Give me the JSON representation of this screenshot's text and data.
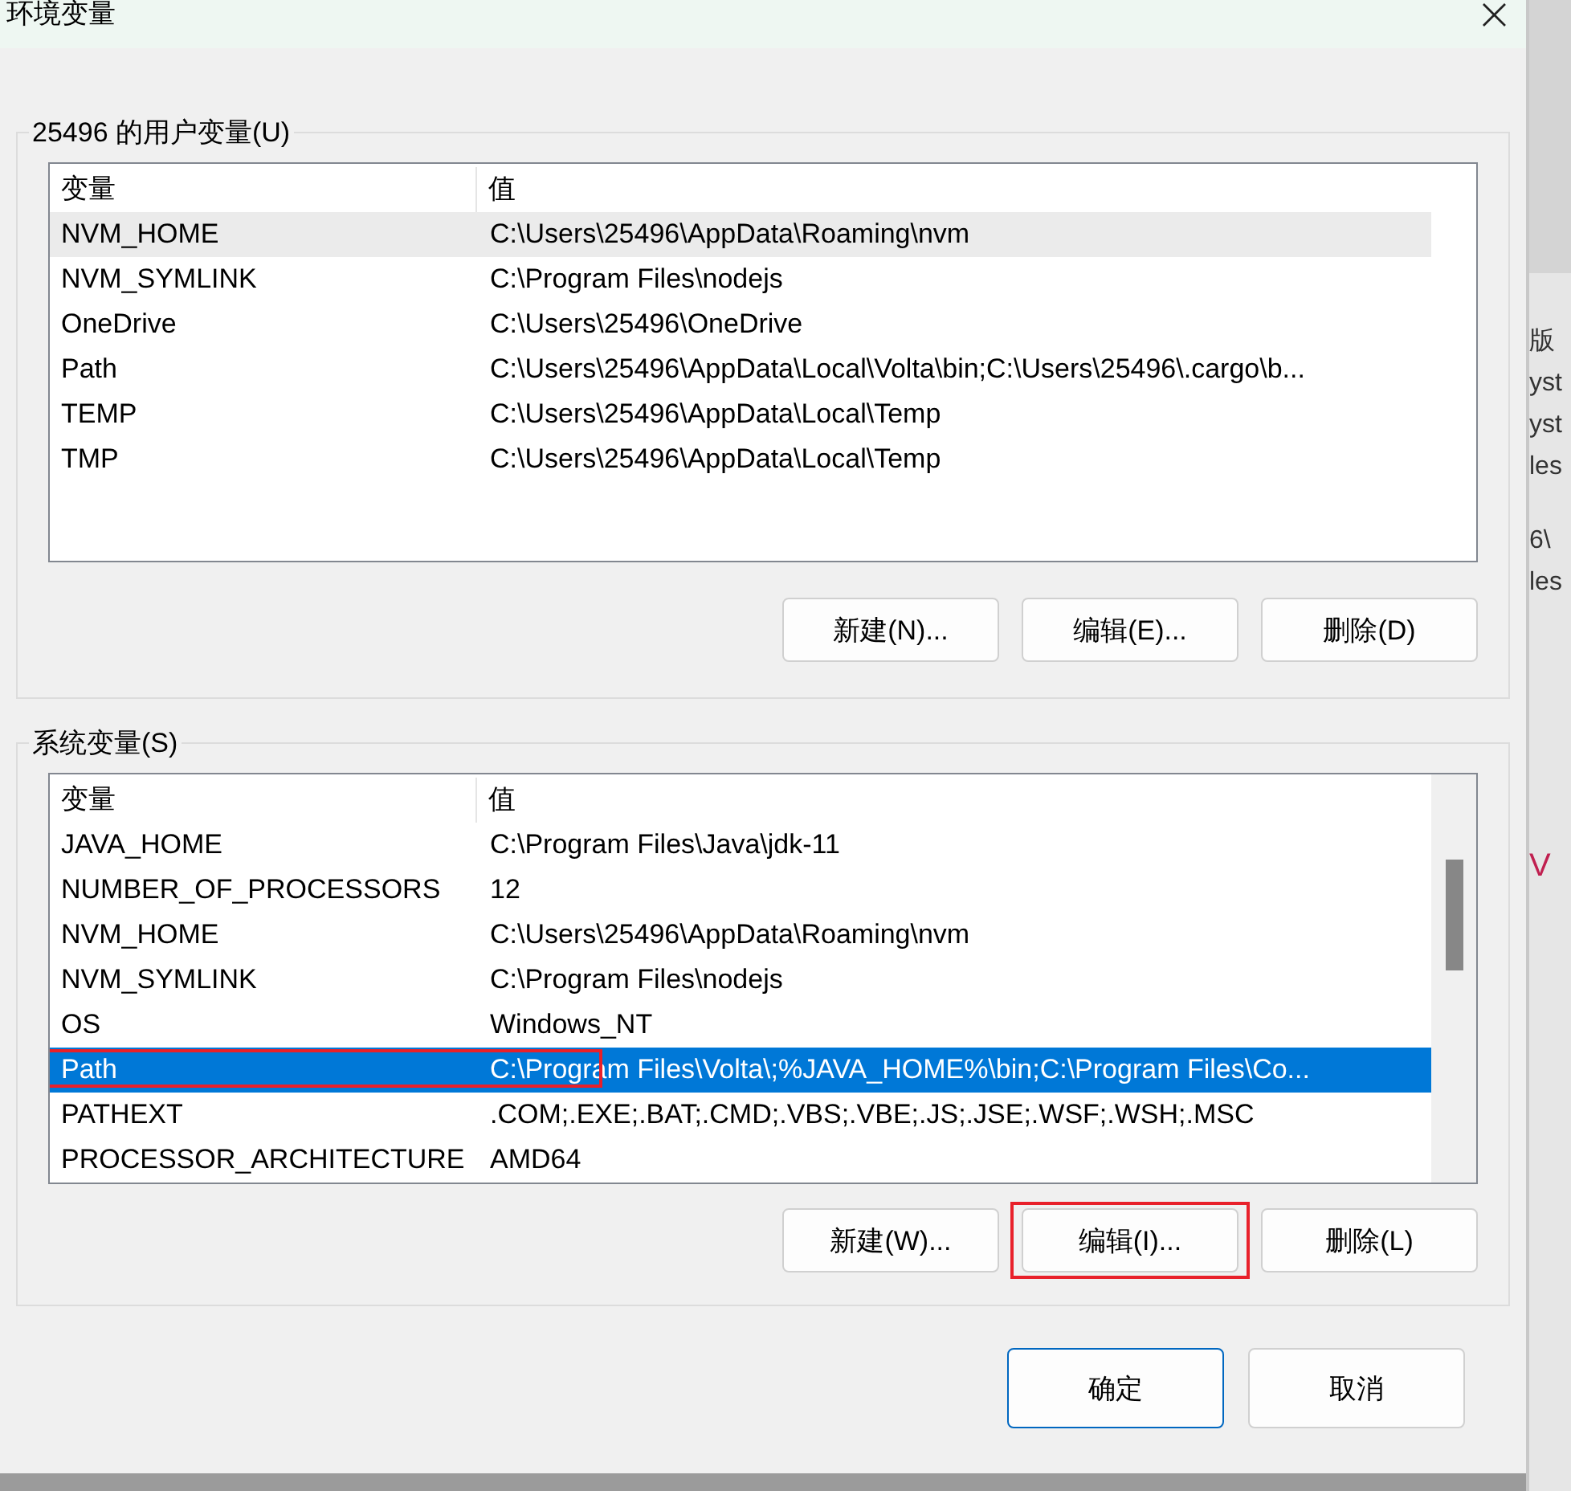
{
  "window": {
    "title": "环境变量",
    "close": "×"
  },
  "user_variables": {
    "legend": "25496 的用户变量(U)",
    "columns": [
      "变量",
      "值"
    ],
    "rows": [
      {
        "name": "NVM_HOME",
        "value": "C:\\Users\\25496\\AppData\\Roaming\\nvm",
        "selected": false,
        "hovered": true,
        "highlighted": false
      },
      {
        "name": "NVM_SYMLINK",
        "value": "C:\\Program Files\\nodejs",
        "selected": false,
        "hovered": false,
        "highlighted": false
      },
      {
        "name": "OneDrive",
        "value": "C:\\Users\\25496\\OneDrive",
        "selected": false,
        "hovered": false,
        "highlighted": false
      },
      {
        "name": "Path",
        "value": "C:\\Users\\25496\\AppData\\Local\\Volta\\bin;C:\\Users\\25496\\.cargo\\b...",
        "selected": false,
        "hovered": false,
        "highlighted": false
      },
      {
        "name": "TEMP",
        "value": "C:\\Users\\25496\\AppData\\Local\\Temp",
        "selected": false,
        "hovered": false,
        "highlighted": false
      },
      {
        "name": "TMP",
        "value": "C:\\Users\\25496\\AppData\\Local\\Temp",
        "selected": false,
        "hovered": false,
        "highlighted": false
      }
    ],
    "buttons": [
      {
        "label": "新建(N)...",
        "highlighted": false
      },
      {
        "label": "编辑(E)...",
        "highlighted": false
      },
      {
        "label": "删除(D)",
        "highlighted": false
      }
    ]
  },
  "system_variables": {
    "legend": "系统变量(S)",
    "columns": [
      "变量",
      "值"
    ],
    "scrollbar": true,
    "rows": [
      {
        "name": "JAVA_HOME",
        "value": "C:\\Program Files\\Java\\jdk-11",
        "selected": false,
        "hovered": false,
        "highlighted": false
      },
      {
        "name": "NUMBER_OF_PROCESSORS",
        "value": "12",
        "selected": false,
        "hovered": false,
        "highlighted": false
      },
      {
        "name": "NVM_HOME",
        "value": "C:\\Users\\25496\\AppData\\Roaming\\nvm",
        "selected": false,
        "hovered": false,
        "highlighted": false
      },
      {
        "name": "NVM_SYMLINK",
        "value": "C:\\Program Files\\nodejs",
        "selected": false,
        "hovered": false,
        "highlighted": false
      },
      {
        "name": "OS",
        "value": "Windows_NT",
        "selected": false,
        "hovered": false,
        "highlighted": false
      },
      {
        "name": "Path",
        "value": "C:\\Program Files\\Volta\\;%JAVA_HOME%\\bin;C:\\Program Files\\Co...",
        "selected": true,
        "hovered": false,
        "highlighted": true
      },
      {
        "name": "PATHEXT",
        "value": ".COM;.EXE;.BAT;.CMD;.VBS;.VBE;.JS;.JSE;.WSF;.WSH;.MSC",
        "selected": false,
        "hovered": false,
        "highlighted": false
      },
      {
        "name": "PROCESSOR_ARCHITECTURE",
        "value": "AMD64",
        "selected": false,
        "hovered": false,
        "highlighted": false
      }
    ],
    "buttons": [
      {
        "label": "新建(W)...",
        "highlighted": false
      },
      {
        "label": "编辑(I)...",
        "highlighted": true
      },
      {
        "label": "删除(L)",
        "highlighted": false
      }
    ]
  },
  "footer_buttons": [
    {
      "label": "确定",
      "focused": true
    },
    {
      "label": "取消",
      "focused": false
    }
  ],
  "background_window": {
    "fragments": [
      "版",
      "yst",
      "yst",
      "les",
      "6\\",
      "les",
      "V"
    ]
  }
}
